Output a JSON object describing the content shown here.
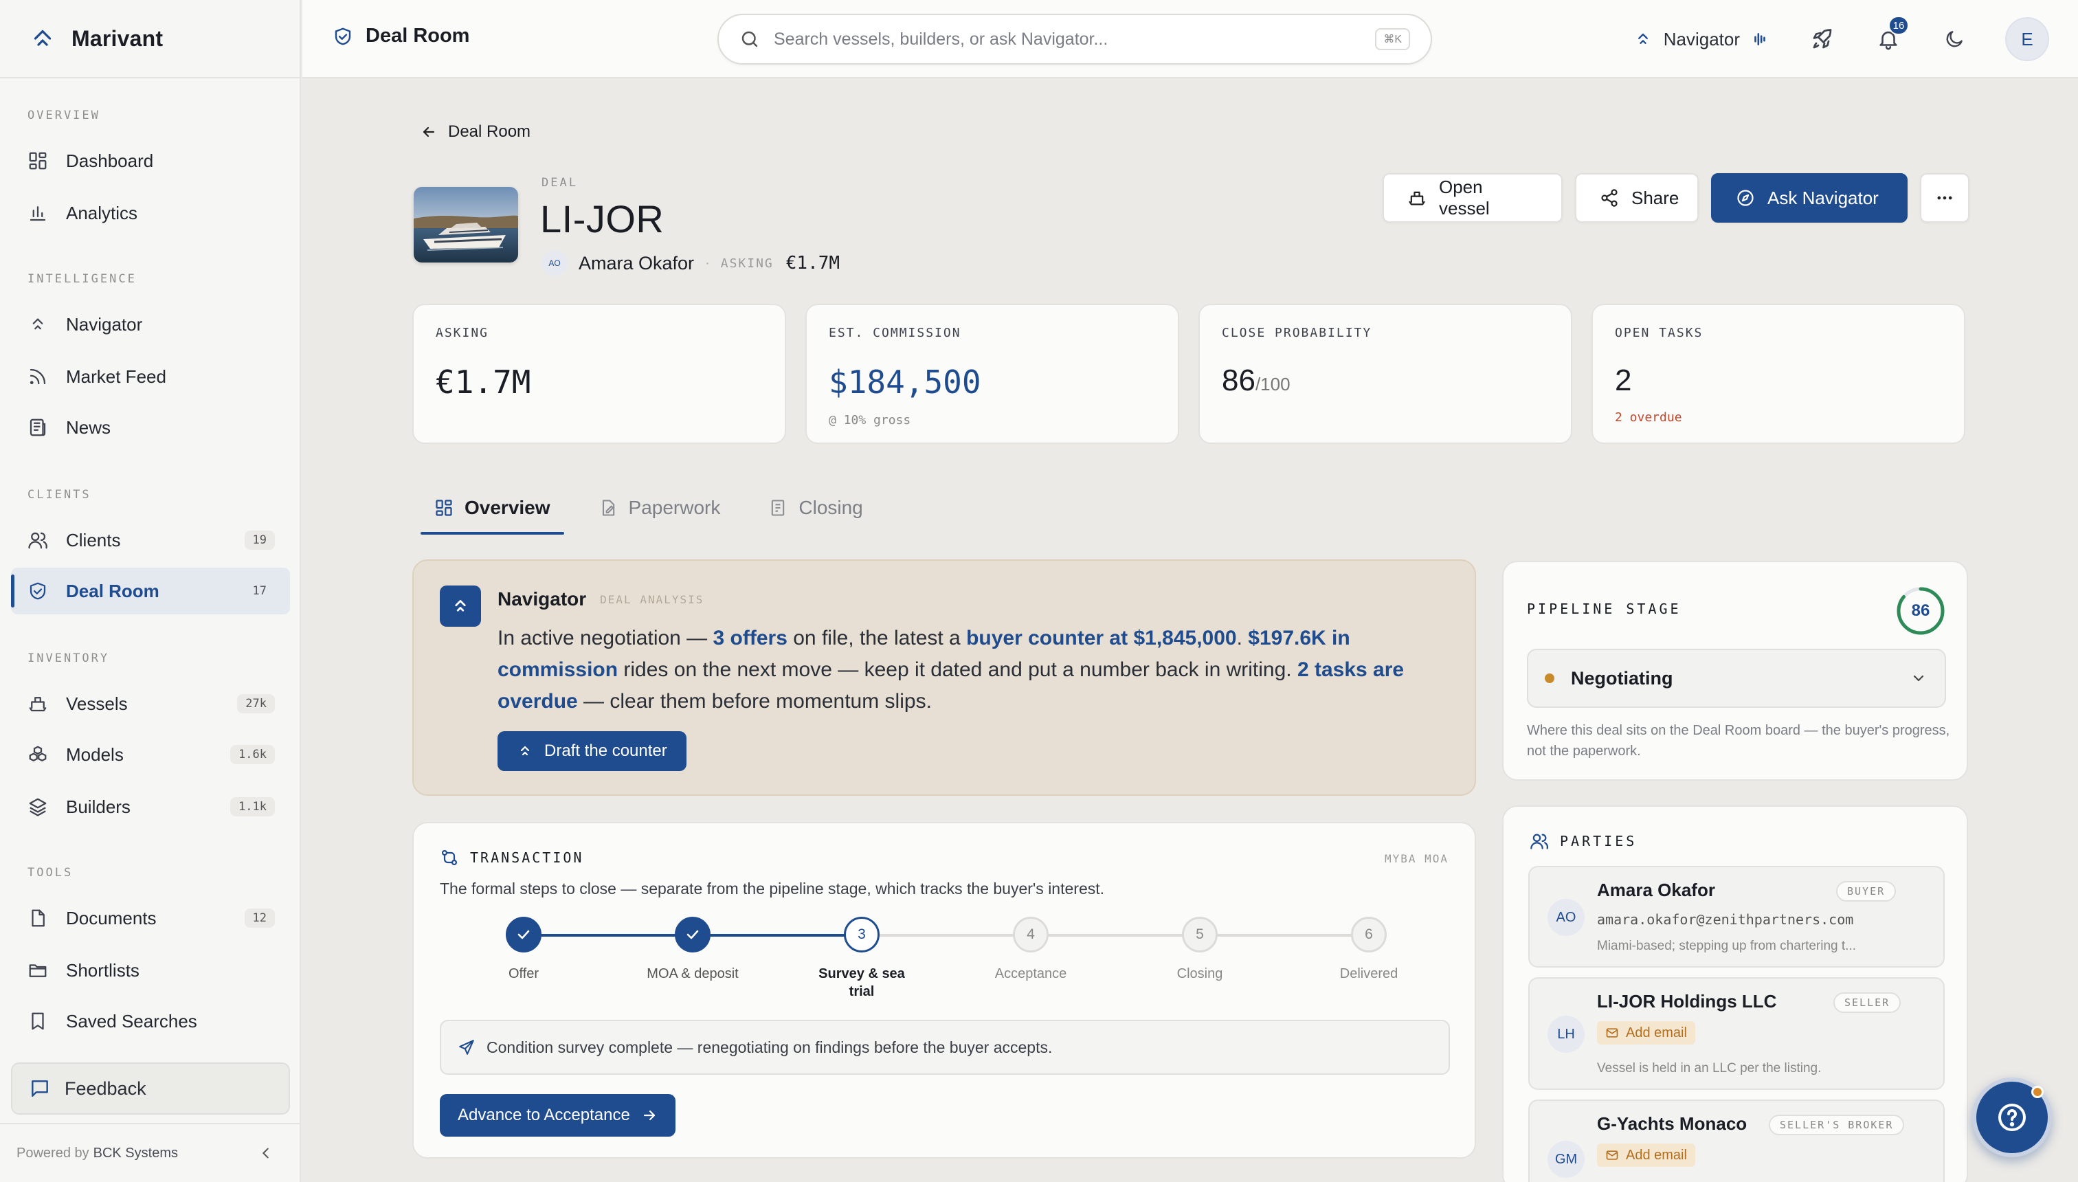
{
  "app": {
    "brand": "Marivant"
  },
  "sidebar": {
    "sections": [
      "OVERVIEW",
      "INTELLIGENCE",
      "CLIENTS",
      "INVENTORY",
      "TOOLS"
    ],
    "items": [
      {
        "label": "Dashboard",
        "count": ""
      },
      {
        "label": "Analytics",
        "count": ""
      },
      {
        "label": "Navigator",
        "count": ""
      },
      {
        "label": "Market Feed",
        "count": ""
      },
      {
        "label": "News",
        "count": ""
      },
      {
        "label": "Clients",
        "count": "19"
      },
      {
        "label": "Deal Room",
        "count": "17"
      },
      {
        "label": "Vessels",
        "count": "27k"
      },
      {
        "label": "Models",
        "count": "1.6k"
      },
      {
        "label": "Builders",
        "count": "1.1k"
      },
      {
        "label": "Documents",
        "count": "12"
      },
      {
        "label": "Shortlists",
        "count": ""
      },
      {
        "label": "Saved Searches",
        "count": ""
      }
    ],
    "feedback": "Feedback",
    "powered_prefix": "Powered by",
    "powered_by": "BCK Systems"
  },
  "topbar": {
    "title": "Deal Room",
    "search_placeholder": "Search vessels, builders, or ask Navigator...",
    "search_shortcut": "⌘K",
    "navigator_label": "Navigator",
    "notifications": "16",
    "user_initial": "E"
  },
  "deal": {
    "back_label": "Deal Room",
    "label": "DEAL",
    "title": "LI-JOR",
    "client_initials": "AO",
    "client_name": "Amara Okafor",
    "asking_label": "ASKING",
    "asking_value": "€1.7M",
    "actions": {
      "open_vessel": "Open vessel",
      "share": "Share",
      "ask_navigator": "Ask Navigator"
    }
  },
  "kpis": [
    {
      "label": "ASKING",
      "value": "€1.7M",
      "sub": ""
    },
    {
      "label": "EST. COMMISSION",
      "value": "$184,500",
      "sub": "@ 10% gross"
    },
    {
      "label": "CLOSE PROBABILITY",
      "value": "86",
      "unit": "/100",
      "sub": ""
    },
    {
      "label": "OPEN TASKS",
      "value": "2",
      "sub": "2 overdue"
    }
  ],
  "tabs": [
    "Overview",
    "Paperwork",
    "Closing"
  ],
  "navigator_card": {
    "title": "Navigator",
    "tag": "DEAL ANALYSIS",
    "body": {
      "t1": "In active negotiation — ",
      "h1": "3 offers",
      "t2": " on file, the latest a ",
      "h2": "buyer counter at $1,845,000",
      "t3": ". ",
      "h3": "$197.6K in commission",
      "t4": " rides on the next move — keep it dated and put a number back in writing. ",
      "h4": "2 tasks are overdue",
      "t5": " — clear them before momentum slips."
    },
    "cta": "Draft the counter"
  },
  "transaction": {
    "title": "TRANSACTION",
    "tag": "MYBA MOA",
    "description": "The formal steps to close — separate from the pipeline stage, which tracks the buyer's interest.",
    "steps": [
      {
        "num": "1",
        "label": "Offer",
        "state": "done"
      },
      {
        "num": "2",
        "label": "MOA & deposit",
        "state": "done"
      },
      {
        "num": "3",
        "label": "Survey & sea trial",
        "state": "current"
      },
      {
        "num": "4",
        "label": "Acceptance",
        "state": "todo"
      },
      {
        "num": "5",
        "label": "Closing",
        "state": "todo"
      },
      {
        "num": "6",
        "label": "Delivered",
        "state": "todo"
      }
    ],
    "note": "Condition survey complete — renegotiating on findings before the buyer accepts.",
    "advance": "Advance to Acceptance"
  },
  "pipeline": {
    "title": "PIPELINE STAGE",
    "score": "86",
    "score_fraction": 0.86,
    "stage": "Negotiating",
    "help": "Where this deal sits on the Deal Room board — the buyer's progress, not the paperwork.",
    "colors": {
      "stage_dot": "#c98a2c"
    }
  },
  "parties": {
    "title": "PARTIES",
    "list": [
      {
        "initials": "AO",
        "name": "Amara Okafor",
        "role": "BUYER",
        "email": "amara.okafor@zenithpartners.com",
        "note": "Miami-based; stepping up from chartering t..."
      },
      {
        "initials": "LH",
        "name": "LI-JOR Holdings LLC",
        "role": "SELLER",
        "add_email": "Add email",
        "note": "Vessel is held in an LLC per the listing."
      },
      {
        "initials": "GM",
        "name": "G-Yachts Monaco",
        "role": "SELLER'S BROKER",
        "add_email": "Add email",
        "note": ""
      }
    ]
  },
  "colors": {
    "accent": "#1f4b8f",
    "overdue": "#c0472e",
    "warning": "#b26e1e"
  }
}
